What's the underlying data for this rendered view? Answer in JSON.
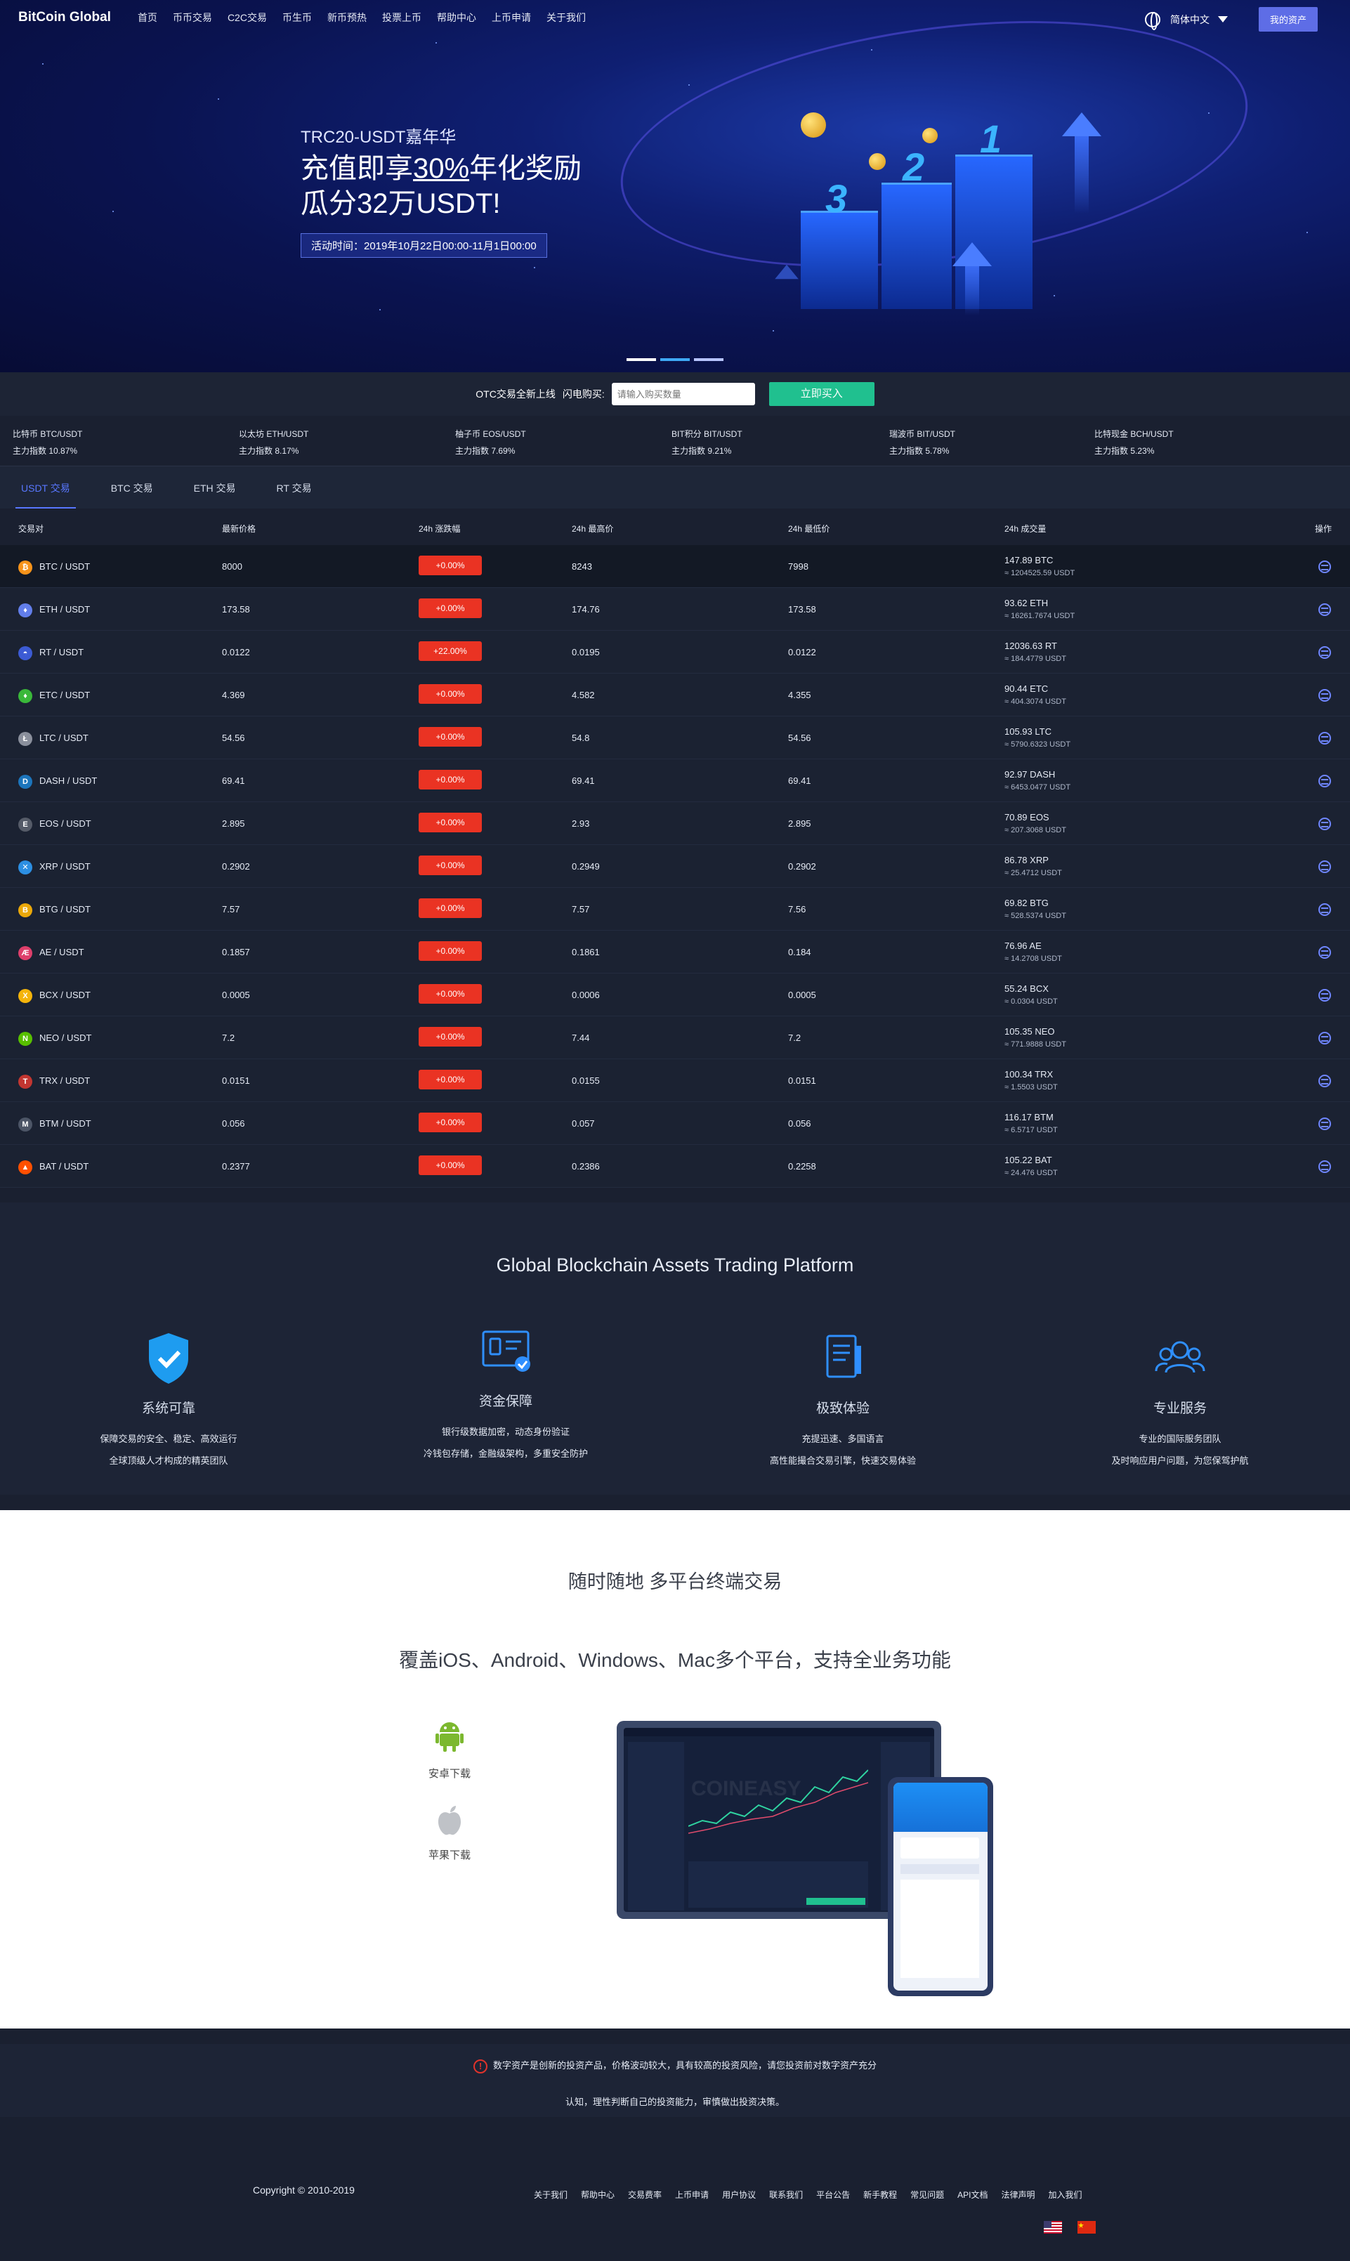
{
  "nav": {
    "brand": "BitCoin Global",
    "links": [
      "首页",
      "币币交易",
      "C2C交易",
      "币生币",
      "新币预热",
      "投票上币",
      "帮助中心",
      "上币申请",
      "关于我们"
    ],
    "language": "简体中文",
    "assets_button": "我的资产"
  },
  "hero": {
    "subtitle": "TRC20-USDT嘉年华",
    "line1_pre": "充值即享",
    "line1_highlight": "30%",
    "line1_post": "年化奖励",
    "line2": "瓜分32万USDT!",
    "time": "活动时间：2019年10月22日00:00-11月1日00:00",
    "numbers": [
      "3",
      "2",
      "1"
    ]
  },
  "otc": {
    "notice": "OTC交易全新上线",
    "label": "闪电购买:",
    "placeholder": "请输入购买数量",
    "button": "立即买入"
  },
  "indices": [
    {
      "name": "比特币 BTC/USDT",
      "value": "主力指数 10.87%"
    },
    {
      "name": "以太坊 ETH/USDT",
      "value": "主力指数 8.17%"
    },
    {
      "name": "柚子币 EOS/USDT",
      "value": "主力指数 7.69%"
    },
    {
      "name": "BIT积分 BIT/USDT",
      "value": "主力指数 9.21%"
    },
    {
      "name": "瑞波币 BIT/USDT",
      "value": "主力指数 5.78%"
    },
    {
      "name": "比特现金 BCH/USDT",
      "value": "主力指数 5.23%"
    }
  ],
  "tabs": [
    "USDT 交易",
    "BTC 交易",
    "ETH 交易",
    "RT 交易"
  ],
  "table": {
    "headers": [
      "交易对",
      "最新价格",
      "24h 涨跌幅",
      "24h 最高价",
      "24h 最低价",
      "24h 成交量",
      "操作"
    ],
    "rows": [
      {
        "pair": "BTC / USDT",
        "icon": "₿",
        "color": "#f7931a",
        "price": "8000",
        "change": "+0.00%",
        "high": "8243",
        "low": "7998",
        "vol": "147.89 BTC",
        "vol_usdt": "≈ 1204525.59 USDT"
      },
      {
        "pair": "ETH / USDT",
        "icon": "♦",
        "color": "#627eea",
        "price": "173.58",
        "change": "+0.00%",
        "high": "174.76",
        "low": "173.58",
        "vol": "93.62 ETH",
        "vol_usdt": "≈ 16261.7674 USDT"
      },
      {
        "pair": "RT / USDT",
        "icon": "◓",
        "color": "#3c5bd4",
        "price": "0.0122",
        "change": "+22.00%",
        "high": "0.0195",
        "low": "0.0122",
        "vol": "12036.63 RT",
        "vol_usdt": "≈ 184.4779 USDT"
      },
      {
        "pair": "ETC / USDT",
        "icon": "♦",
        "color": "#3ab83a",
        "price": "4.369",
        "change": "+0.00%",
        "high": "4.582",
        "low": "4.355",
        "vol": "90.44 ETC",
        "vol_usdt": "≈ 404.3074 USDT"
      },
      {
        "pair": "LTC / USDT",
        "icon": "Ł",
        "color": "#8a8f9c",
        "price": "54.56",
        "change": "+0.00%",
        "high": "54.8",
        "low": "54.56",
        "vol": "105.93 LTC",
        "vol_usdt": "≈ 5790.6323 USDT"
      },
      {
        "pair": "DASH / USDT",
        "icon": "D",
        "color": "#1c75bc",
        "price": "69.41",
        "change": "+0.00%",
        "high": "69.41",
        "low": "69.41",
        "vol": "92.97 DASH",
        "vol_usdt": "≈ 6453.0477 USDT"
      },
      {
        "pair": "EOS / USDT",
        "icon": "E",
        "color": "#555b68",
        "price": "2.895",
        "change": "+0.00%",
        "high": "2.93",
        "low": "2.895",
        "vol": "70.89 EOS",
        "vol_usdt": "≈ 207.3068 USDT"
      },
      {
        "pair": "XRP / USDT",
        "icon": "✕",
        "color": "#2c8fe3",
        "price": "0.2902",
        "change": "+0.00%",
        "high": "0.2949",
        "low": "0.2902",
        "vol": "86.78 XRP",
        "vol_usdt": "≈ 25.4712 USDT"
      },
      {
        "pair": "BTG / USDT",
        "icon": "B",
        "color": "#eba809",
        "price": "7.57",
        "change": "+0.00%",
        "high": "7.57",
        "low": "7.56",
        "vol": "69.82 BTG",
        "vol_usdt": "≈ 528.5374 USDT"
      },
      {
        "pair": "AE / USDT",
        "icon": "Æ",
        "color": "#de3f6b",
        "price": "0.1857",
        "change": "+0.00%",
        "high": "0.1861",
        "low": "0.184",
        "vol": "76.96 AE",
        "vol_usdt": "≈ 14.2708 USDT"
      },
      {
        "pair": "BCX / USDT",
        "icon": "X",
        "color": "#f4b40b",
        "price": "0.0005",
        "change": "+0.00%",
        "high": "0.0006",
        "low": "0.0005",
        "vol": "55.24 BCX",
        "vol_usdt": "≈ 0.0304 USDT"
      },
      {
        "pair": "NEO / USDT",
        "icon": "N",
        "color": "#58bf00",
        "price": "7.2",
        "change": "+0.00%",
        "high": "7.44",
        "low": "7.2",
        "vol": "105.35 NEO",
        "vol_usdt": "≈ 771.9888 USDT"
      },
      {
        "pair": "TRX / USDT",
        "icon": "T",
        "color": "#c23631",
        "price": "0.0151",
        "change": "+0.00%",
        "high": "0.0155",
        "low": "0.0151",
        "vol": "100.34 TRX",
        "vol_usdt": "≈ 1.5503 USDT"
      },
      {
        "pair": "BTM / USDT",
        "icon": "M",
        "color": "#4c5566",
        "price": "0.056",
        "change": "+0.00%",
        "high": "0.057",
        "low": "0.056",
        "vol": "116.17 BTM",
        "vol_usdt": "≈ 6.5717 USDT"
      },
      {
        "pair": "BAT / USDT",
        "icon": "▲",
        "color": "#ff5000",
        "price": "0.2377",
        "change": "+0.00%",
        "high": "0.2386",
        "low": "0.2258",
        "vol": "105.22 BAT",
        "vol_usdt": "≈ 24.476 USDT"
      }
    ]
  },
  "features": {
    "title": "Global Blockchain Assets Trading Platform",
    "items": [
      {
        "name": "系统可靠",
        "desc1": "保障交易的安全、稳定、高效运行",
        "desc2": "全球顶级人才构成的精英团队",
        "icon": "shield-check-icon"
      },
      {
        "name": "资金保障",
        "desc1": "银行级数据加密，动态身份验证",
        "desc2": "冷钱包存储，金融级架构，多重安全防护",
        "icon": "secure-card-icon"
      },
      {
        "name": "极致体验",
        "desc1": "充提迅速、多国语言",
        "desc2": "高性能撮合交易引擎，快速交易体验",
        "icon": "document-icon"
      },
      {
        "name": "专业服务",
        "desc1": "专业的国际服务团队",
        "desc2": "及时响应用户问题，为您保驾护航",
        "icon": "users-icon"
      }
    ]
  },
  "platforms": {
    "title": "随时随地 多平台终端交易",
    "subtitle": "覆盖iOS、Android、Windows、Mac多个平台，支持全业务功能",
    "android": "安卓下载",
    "apple": "苹果下载",
    "mockup_logo": "COINEASY"
  },
  "risk": {
    "line1": "数字资产是创新的投资产品，价格波动较大，具有较高的投资风险，请您投资前对数字资产充分",
    "line2": "认知，理性判断自己的投资能力，审慎做出投资决策。"
  },
  "footer": {
    "copyright": "Copyright © 2010-2019",
    "links": [
      "关于我们",
      "帮助中心",
      "交易费率",
      "上币申请",
      "用户协议",
      "联系我们",
      "平台公告",
      "新手教程",
      "常见问题",
      "API文档",
      "法律声明",
      "加入我们"
    ]
  },
  "colors": {
    "accent": "#5877ff",
    "buy": "#20c08f",
    "down": "#ea3323",
    "hero_bg": "#0a1350"
  }
}
